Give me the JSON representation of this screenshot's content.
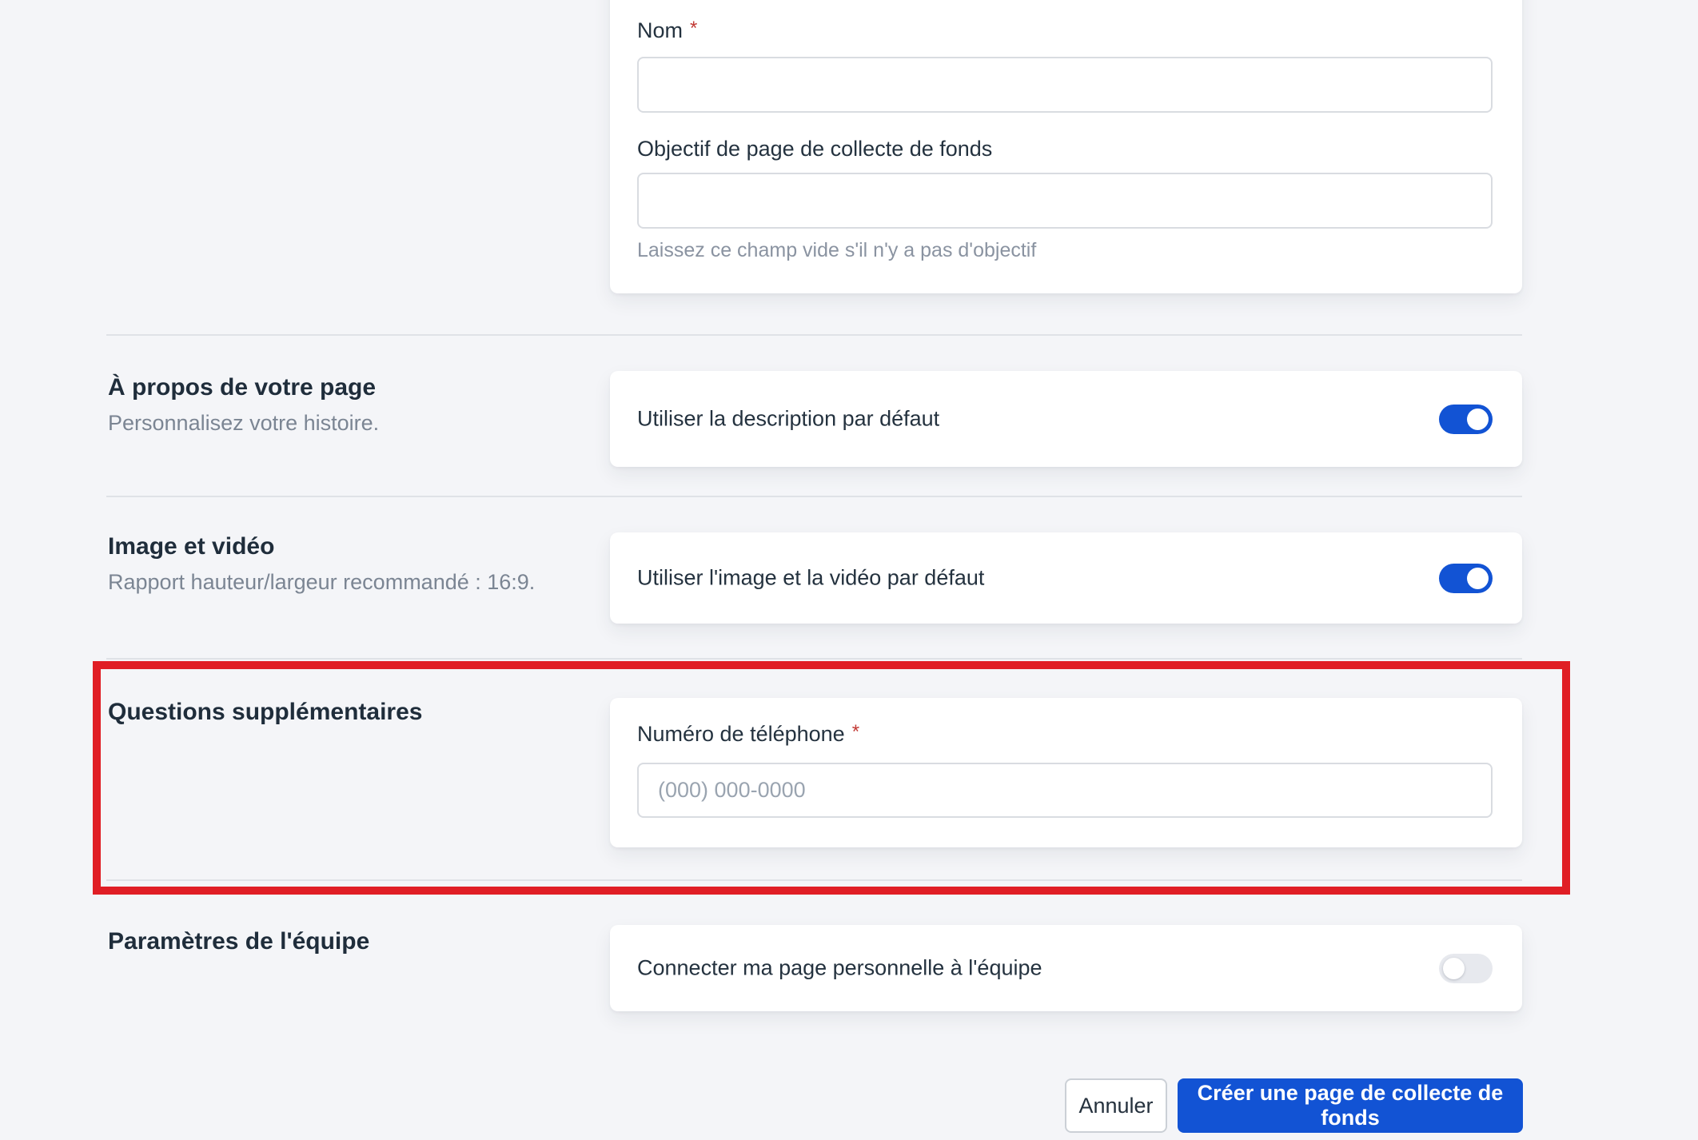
{
  "colors": {
    "page_bg": "#f4f5f8",
    "accent": "#1253d4",
    "highlight": "#e01e25",
    "required": "#c23934",
    "toggle_off": "#e7e9ee"
  },
  "details_card": {
    "name_label": "Nom",
    "required_marker": "*",
    "name_value": "",
    "goal_label": "Objectif de page de collecte de fonds",
    "goal_value": "",
    "goal_helper": "Laissez ce champ vide s'il n'y a pas d'objectif"
  },
  "sections": [
    {
      "title": "À propos de votre page",
      "subtitle": "Personnalisez votre histoire.",
      "card_label": "Utiliser la description par défaut",
      "toggle_on": true
    },
    {
      "title": "Image et vidéo",
      "subtitle": "Rapport hauteur/largeur recommandé : 16:9.",
      "card_label": "Utiliser l'image et la vidéo par défaut",
      "toggle_on": true
    },
    {
      "title": "Questions supplémentaires",
      "highlighted": true,
      "phone_label": "Numéro de téléphone",
      "required_marker": "*",
      "phone_placeholder": "(000) 000-0000",
      "phone_value": ""
    },
    {
      "title": "Paramètres de l'équipe",
      "card_label": "Connecter ma page personnelle à l'équipe",
      "toggle_on": false
    }
  ],
  "footer": {
    "cancel_label": "Annuler",
    "submit_label": "Créer une page de collecte de fonds"
  }
}
